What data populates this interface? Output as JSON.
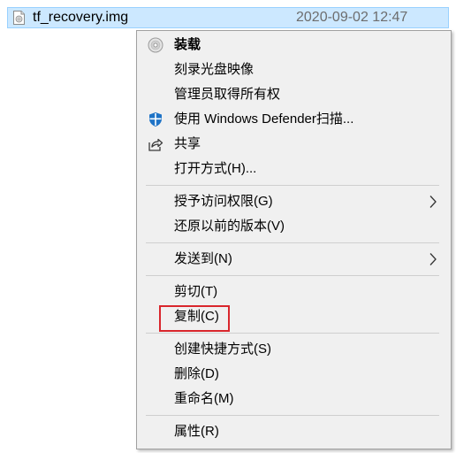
{
  "file": {
    "name": "tf_recovery.img",
    "date": "2020-09-02 12:47",
    "icon": "disc-image-file-icon"
  },
  "menu": {
    "items": [
      {
        "label": "装载",
        "icon": "disc-mount-icon",
        "bold": true
      },
      {
        "label": "刻录光盘映像"
      },
      {
        "label": "管理员取得所有权"
      },
      {
        "label": "使用 Windows Defender扫描...",
        "icon": "defender-shield-icon"
      },
      {
        "label": "共享",
        "icon": "share-icon"
      },
      {
        "label": "打开方式(H)..."
      },
      {
        "label": "授予访问权限(G)",
        "submenu": true
      },
      {
        "label": "还原以前的版本(V)"
      },
      {
        "label": "发送到(N)",
        "submenu": true
      },
      {
        "label": "剪切(T)"
      },
      {
        "label": "复制(C)",
        "highlighted": true
      },
      {
        "label": "创建快捷方式(S)"
      },
      {
        "label": "删除(D)"
      },
      {
        "label": "重命名(M)"
      },
      {
        "label": "属性(R)"
      }
    ]
  },
  "colors": {
    "selection_bg": "#cce8ff",
    "menu_bg": "#f0f0f0",
    "highlight_border": "#d9262c",
    "defender_blue": "#1e73c6"
  }
}
